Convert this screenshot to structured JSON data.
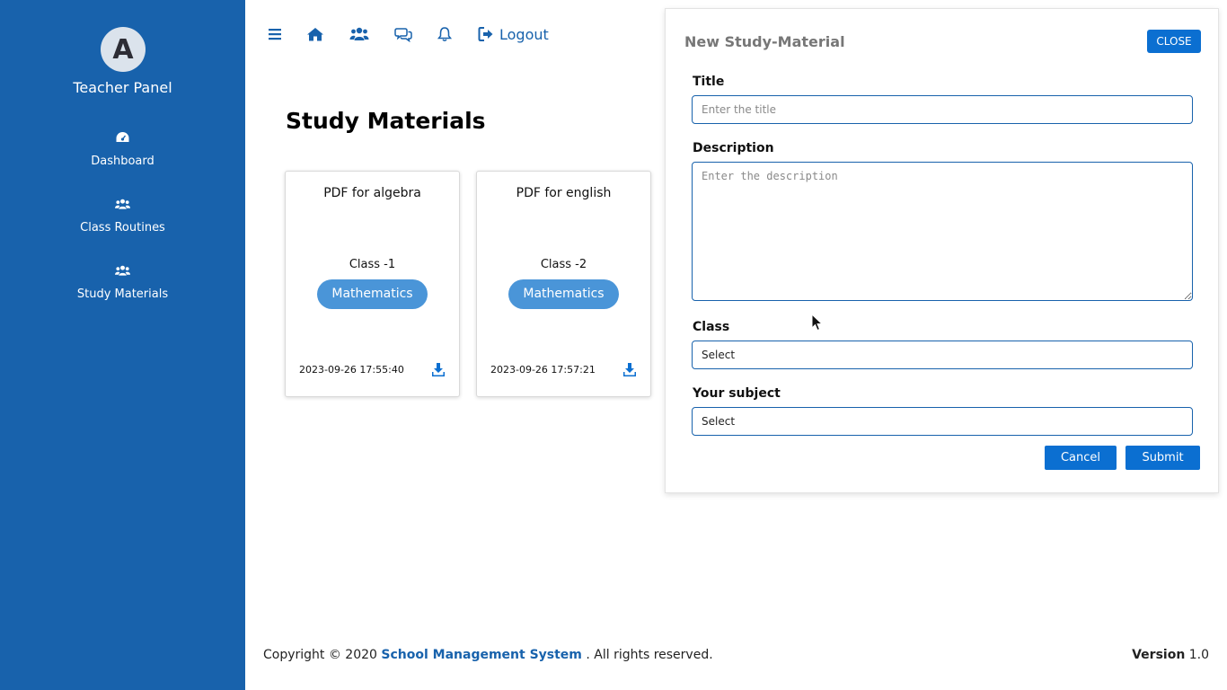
{
  "sidebar": {
    "brand_letter": "A",
    "brand_title": "Teacher Panel",
    "items": [
      {
        "label": "Dashboard",
        "icon": "gauge-icon"
      },
      {
        "label": "Class Routines",
        "icon": "users-icon"
      },
      {
        "label": "Study Materials",
        "icon": "users-icon"
      }
    ]
  },
  "topbar": {
    "icons": [
      "menu-icon",
      "home-icon",
      "users-icon",
      "chat-icon",
      "bell-icon"
    ],
    "logout_label": "Logout"
  },
  "main": {
    "title": "Study Materials",
    "cards": [
      {
        "title": "PDF for algebra",
        "class": "Class -1",
        "subject": "Mathematics",
        "date": "2023-09-26 17:55:40"
      },
      {
        "title": "PDF for english",
        "class": "Class -2",
        "subject": "Mathematics",
        "date": "2023-09-26 17:57:21"
      }
    ]
  },
  "panel": {
    "title": "New Study-Material",
    "close_label": "CLOSE",
    "title_label": "Title",
    "title_placeholder": "Enter the title",
    "description_label": "Description",
    "description_placeholder": "Enter the description",
    "class_label": "Class",
    "class_value": "Select",
    "subject_label": "Your subject",
    "subject_value": "Select",
    "cancel_label": "Cancel",
    "submit_label": "Submit"
  },
  "footer": {
    "copyright_prefix": "Copyright © 2020",
    "system_name": "School Management System",
    "rights": ". All rights reserved.",
    "version_label": "Version",
    "version_value": "1.0"
  },
  "colors": {
    "sidebar_bg": "#1862ac",
    "accent": "#0b6fd1",
    "subject_badge": "#4a95d8"
  }
}
